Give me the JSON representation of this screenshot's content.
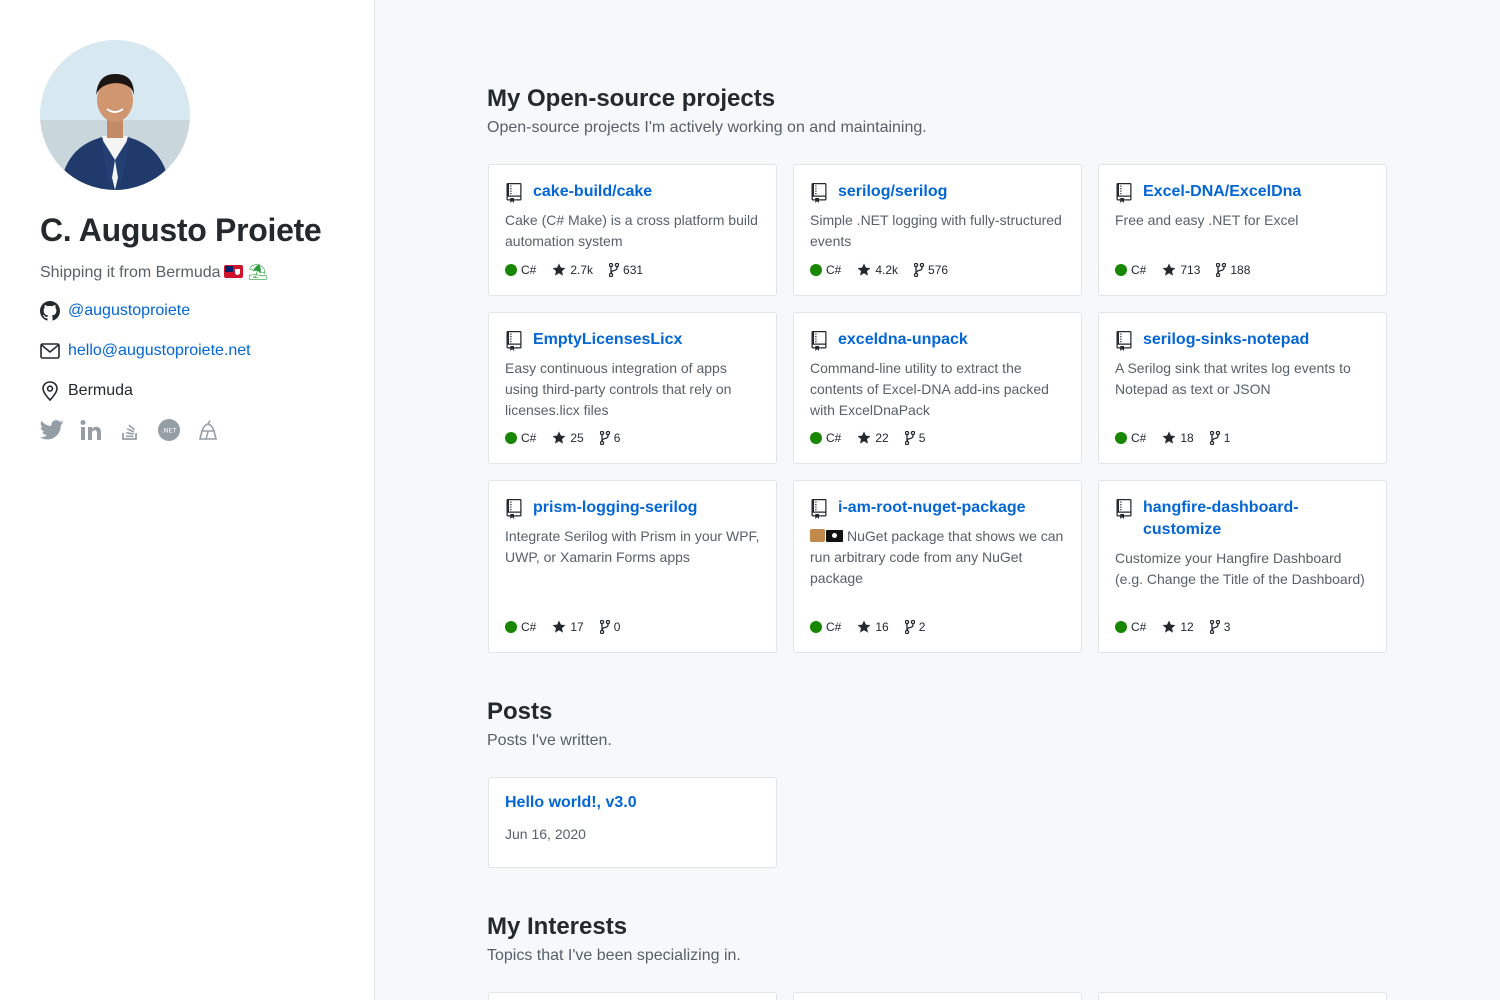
{
  "profile": {
    "name": "C. Augusto Proiete",
    "tagline": "Shipping it from Bermuda",
    "github": "@augustoproiete",
    "email": "hello@augustoproiete.net",
    "location": "Bermuda",
    "social_icons": [
      "twitter-icon",
      "linkedin-icon",
      "stackoverflow-icon",
      "dotnet-icon",
      "cake-icon"
    ]
  },
  "projects_section": {
    "title": "My Open-source projects",
    "subtitle": "Open-source projects I'm actively working on and maintaining."
  },
  "projects": [
    {
      "name": "cake-build/cake",
      "description": "Cake (C# Make) is a cross platform build automation system",
      "language": "C#",
      "stars": "2.7k",
      "forks": "631"
    },
    {
      "name": "serilog/serilog",
      "description": "Simple .NET logging with fully-structured events",
      "language": "C#",
      "stars": "4.2k",
      "forks": "576"
    },
    {
      "name": "Excel-DNA/ExcelDna",
      "description": "Free and easy .NET for Excel",
      "language": "C#",
      "stars": "713",
      "forks": "188"
    },
    {
      "name": "EmptyLicensesLicx",
      "description": "Easy continuous integration of apps using third-party controls that rely on licenses.licx files",
      "language": "C#",
      "stars": "25",
      "forks": "6"
    },
    {
      "name": "exceldna-unpack",
      "description": "Command-line utility to extract the contents of Excel-DNA add-ins packed with ExcelDnaPack",
      "language": "C#",
      "stars": "22",
      "forks": "5"
    },
    {
      "name": "serilog-sinks-notepad",
      "description": "A Serilog sink that writes log events to Notepad as text or JSON",
      "language": "C#",
      "stars": "18",
      "forks": "1"
    },
    {
      "name": "prism-logging-serilog",
      "description": "Integrate Serilog with Prism in your WPF, UWP, or Xamarin Forms apps",
      "language": "C#",
      "stars": "17",
      "forks": "0"
    },
    {
      "name": "i-am-root-nuget-package",
      "description": "NuGet package that shows we can run arbitrary code from any NuGet package",
      "language": "C#",
      "stars": "16",
      "forks": "2"
    },
    {
      "name": "hangfire-dashboard-customize",
      "description": "Customize your Hangfire Dashboard (e.g. Change the Title of the Dashboard)",
      "language": "C#",
      "stars": "12",
      "forks": "3"
    }
  ],
  "posts_section": {
    "title": "Posts",
    "subtitle": "Posts I've written."
  },
  "posts": [
    {
      "title": "Hello world!, v3.0",
      "date": "Jun 16, 2020"
    }
  ],
  "interests_section": {
    "title": "My Interests",
    "subtitle": "Topics that I've been specializing in."
  },
  "colors": {
    "link": "#0366d6",
    "csharp": "#178600",
    "muted": "#586069",
    "background": "#f6f8fa"
  }
}
